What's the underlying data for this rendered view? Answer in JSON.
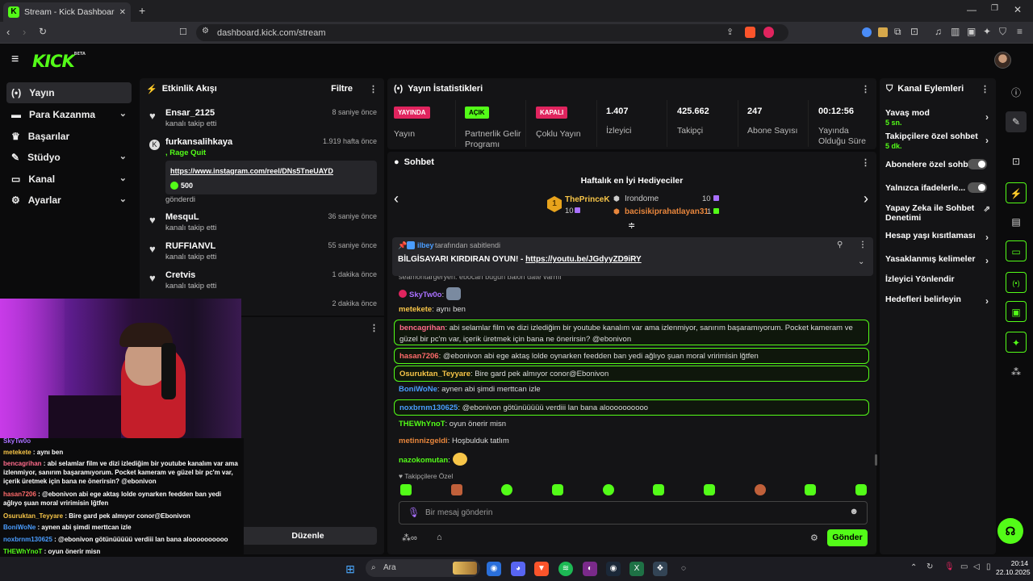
{
  "browser": {
    "tab_title": "Stream - Kick Dashboard",
    "url": "dashboard.kick.com/stream"
  },
  "header": {
    "logo": "KICK",
    "beta": "BETA"
  },
  "sidebar": {
    "items": [
      {
        "label": "Yayın"
      },
      {
        "label": "Para Kazanma"
      },
      {
        "label": "Başarılar"
      },
      {
        "label": "Stüdyo"
      },
      {
        "label": "Kanal"
      },
      {
        "label": "Ayarlar"
      }
    ]
  },
  "activity": {
    "title": "Etkinlik Akışı",
    "filter": "Filtre",
    "events": [
      {
        "name": "Ensar_2125",
        "sub": "kanalı takip etti",
        "time": "8 saniye önce"
      },
      {
        "name": "furkansalihkaya",
        "sub": ", Rage Quit",
        "time": "1.919 hafta önce",
        "link": "https://www.instagram.com/reel/DNs5TneUAYD",
        "amount": "500",
        "after": "gönderdi"
      },
      {
        "name": "MesquL",
        "sub": "kanalı takip etti",
        "time": "36 saniye önce"
      },
      {
        "name": "RUFFIANVL",
        "sub": "kanalı takip etti",
        "time": "55 saniye önce"
      },
      {
        "name": "Cretvis",
        "sub": "kanalı takip etti",
        "time": "1 dakika önce"
      },
      {
        "time": "2 dakika önce"
      }
    ],
    "edit_button": "Düzenle"
  },
  "stats": {
    "title": "Yayın İstatistikleri",
    "items": [
      {
        "badge": "YAYINDA",
        "label": "Yayın",
        "color": "#e0245e"
      },
      {
        "badge": "AÇIK",
        "label": "Partnerlik Gelir Programı",
        "color": "#53fc18"
      },
      {
        "badge": "KAPALI",
        "label": "Çoklu Yayın",
        "color": "#e0245e"
      },
      {
        "value": "1.407",
        "label": "İzleyici"
      },
      {
        "value": "425.662",
        "label": "Takipçi"
      },
      {
        "value": "247",
        "label": "Abone Sayısı"
      },
      {
        "value": "00:12:56",
        "label": "Yayında Olduğu Süre"
      }
    ]
  },
  "chat": {
    "title": "Sohbet",
    "gifters_title": "Haftalık en İyi Hediyeciler",
    "gifters": [
      {
        "rank": "1",
        "name": "ThePrinceK",
        "count": "10"
      },
      {
        "name": "Irondome",
        "count": "10"
      },
      {
        "name": "bacisikiprahatlayan31",
        "count": "1"
      }
    ],
    "pinned_by": "ilbey",
    "pinned_suffix": "tarafından sabitlendi",
    "pinned_text": "BİLGİSAYARI KIRDIRAN OYUN! - ",
    "pinned_link": "https://youtu.be/JGdyyZD9iRY",
    "partial_line": "seamontargeryen: ebocan bugün balon date varmı",
    "messages": [
      {
        "user": "SkyTw0o",
        "text": ":"
      },
      {
        "user": "metekete",
        "text": ": aynı ben"
      },
      {
        "user": "bencagrihan",
        "text": ": abi selamlar film ve dizi izlediğim bir youtube kanalım var ama izlenmiyor, sanırım başaramıyorum. Pocket kameram ve güzel bir pc'm var, içerik üretmek için bana ne önerirsin? @ebonivon"
      },
      {
        "user": "hasan7206",
        "text": ": @ebonivon abi ege aktaş lolde oynarken feedden ban yedi ağlıyo şuan moral vririmisin lğtfen"
      },
      {
        "user": "Osuruktan_Teyyare",
        "text": ": Bire gard pek almıyor conor@Ebonivon"
      },
      {
        "user": "BoniWoNe",
        "text": ": aynen abi şimdi merttcan izle"
      },
      {
        "user": "noxbrnm130625",
        "text": ": @ebonivon götünüüüüü verdiii lan bana aloooooooooo"
      },
      {
        "user": "THEWhYnoT",
        "text": ": oyun önerir misn"
      },
      {
        "user": "metinnizgeldi",
        "text": ": Hoşbulduk tatlım"
      },
      {
        "user": "nazokomutan",
        "text": ":"
      }
    ],
    "emote_label": "Takipçilere Özel",
    "input_placeholder": "Bir mesaj gönderin",
    "send_button": "Gönder"
  },
  "overlay_chat": [
    {
      "user": "SkyTw0o",
      "text": ""
    },
    {
      "user": "metekete",
      "text": " : aynı ben"
    },
    {
      "user": "bencagrihan",
      "text": " : abi selamlar film ve dizi izlediğim bir youtube kanalım var ama izlenmiyor, sanırım başaramıyorum. Pocket kameram ve güzel bir pc'm var, içerik üretmek için bana ne önerirsin? @ebonivon"
    },
    {
      "user": "hasan7206",
      "text": " : @ebonivon abi ege aktaş lolde oynarken feedden ban yedi ağlıyo şuan moral vririmisin lğtfen"
    },
    {
      "user": "Osuruktan_Teyyare",
      "text": " : Bire gard pek almıyor conor@Ebonivon"
    },
    {
      "user": "BoniWoNe",
      "text": " : aynen abi şimdi merttcan izle"
    },
    {
      "user": "noxbrnm130625",
      "text": " : @ebonivon götünüüüüü verdiii lan bana aloooooooooo"
    },
    {
      "user": "THEWhYnoT",
      "text": " : oyun önerir misn"
    },
    {
      "user": "metinnizgeldi",
      "text": " : Hoşbulduk tatlım"
    },
    {
      "user": "nazokomutan",
      "text": " :"
    }
  ],
  "actions": {
    "title": "Kanal Eylemleri",
    "items": [
      {
        "label": "Yavaş mod",
        "value": "5 sn."
      },
      {
        "label": "Takipçilere özel sohbet",
        "value": "5 dk."
      },
      {
        "label": "Abonelere özel sohbet"
      },
      {
        "label": "Yalnızca ifadelerle..."
      },
      {
        "label": "Yapay Zeka ile Sohbet Denetimi"
      },
      {
        "label": "Hesap yaşı kısıtlaması"
      },
      {
        "label": "Yasaklanmış kelimeler"
      },
      {
        "label": "İzleyici Yönlendir"
      },
      {
        "label": "Hedefleri belirleyin"
      }
    ]
  },
  "taskbar": {
    "search": "Ara",
    "time": "20:14",
    "date": "22.10.2025"
  }
}
